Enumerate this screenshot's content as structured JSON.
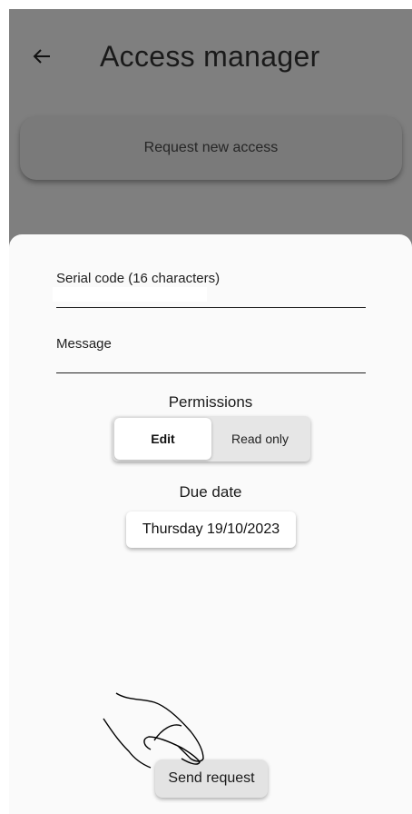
{
  "header": {
    "title": "Access manager",
    "back_icon": "arrow-left-icon"
  },
  "request_card": {
    "label": "Request new access"
  },
  "form": {
    "serial_label": "Serial code (16 characters)",
    "serial_value": "",
    "message_label": "Message",
    "message_value": ""
  },
  "permissions": {
    "title": "Permissions",
    "options": [
      "Edit",
      "Read only"
    ],
    "selected": "Edit"
  },
  "due_date": {
    "title": "Due date",
    "value": "Thursday 19/10/2023"
  },
  "actions": {
    "send_label": "Send request"
  },
  "colors": {
    "scrim": "#7f7f7f",
    "sheet": "#fafafa",
    "button": "#e3e3e3"
  }
}
